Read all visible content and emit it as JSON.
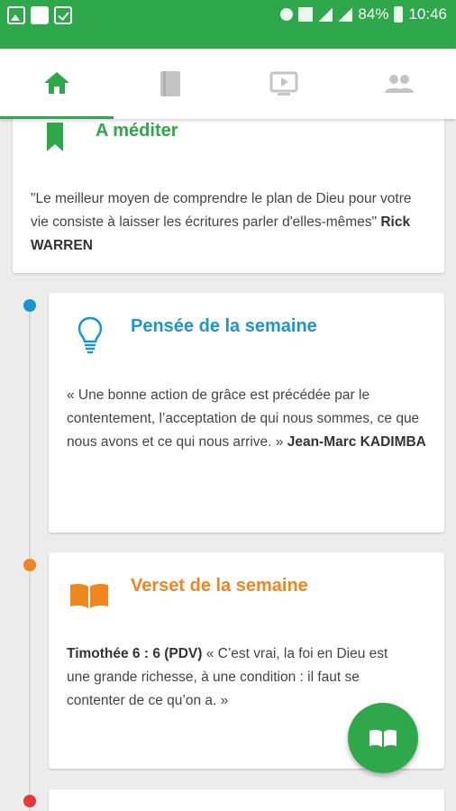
{
  "status_bar": {
    "battery": "84%",
    "time": "10:46"
  },
  "tabs": [
    {
      "name": "home-icon",
      "active": true
    },
    {
      "name": "book-icon",
      "active": false
    },
    {
      "name": "video-icon",
      "active": false
    },
    {
      "name": "people-icon",
      "active": false
    }
  ],
  "cards": {
    "mediter": {
      "title": "A méditer",
      "quote": "\"Le meilleur moyen de comprendre le plan de Dieu pour votre vie consiste à laisser les écritures parler d'elles-mêmes\" ",
      "author": "Rick WARREN",
      "icon": "bookmark-icon",
      "color": "#2ea84a"
    },
    "pensee": {
      "title": "Pensée de la semaine",
      "quote": "« Une bonne action de grâce est précédée par le contentement, l’acceptation de qui nous sommes, ce que nous avons et ce qui nous arrive. » ",
      "author": "Jean-Marc KADIMBA",
      "icon": "lightbulb-icon",
      "color": "#1a96cf"
    },
    "verset": {
      "title": "Verset de la semaine",
      "reference": "Timothée 6 : 6 (PDV)",
      "text": " « C’est vrai, la foi en Dieu est une grande richesse, à une condition : il faut se contenter de ce qu’on a. »",
      "icon": "open-book-icon",
      "color": "#f0861e"
    }
  },
  "timeline_colors": [
    "#1a96cf",
    "#f0861e",
    "#e53935"
  ],
  "fab": {
    "icon": "open-book-icon"
  }
}
